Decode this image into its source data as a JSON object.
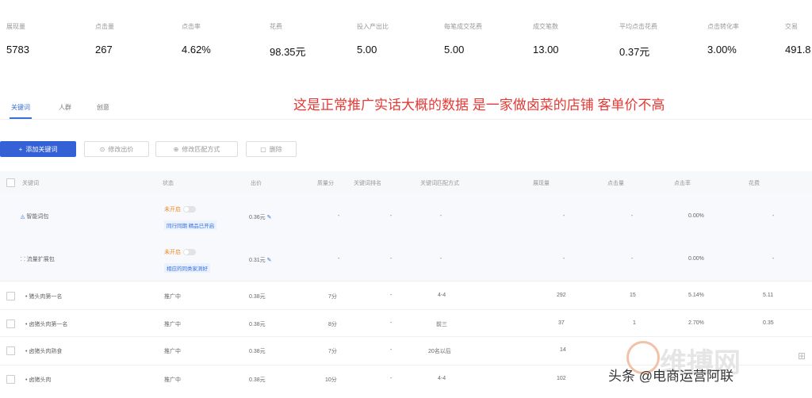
{
  "metrics": [
    {
      "label": "展现量",
      "value": "5783"
    },
    {
      "label": "点击量",
      "value": "267"
    },
    {
      "label": "点击率",
      "value": "4.62%"
    },
    {
      "label": "花费",
      "value": "98.35元"
    },
    {
      "label": "投入产出比",
      "value": "5.00"
    },
    {
      "label": "每笔成交花费",
      "value": "5.00"
    },
    {
      "label": "成交笔数",
      "value": "13.00"
    },
    {
      "label": "平均点击花费",
      "value": "0.37元"
    },
    {
      "label": "点击转化率",
      "value": "3.00%"
    },
    {
      "label": "交易",
      "value": "491.8"
    }
  ],
  "tabs": [
    "关键词",
    "人群",
    "创意"
  ],
  "note": "这是正常推广实话大概的数据 是一家做卤菜的店铺 客单价不高",
  "toolbar": {
    "add": "添加关键词",
    "modify_bid": "修改出价",
    "modify_match": "修改匹配方式",
    "delete": "删除"
  },
  "table": {
    "headers": [
      "关键词",
      "状态",
      "出价",
      "质量分",
      "关键词排名",
      "关键词匹配方式",
      "展现量",
      "点击量",
      "点击率",
      "花费"
    ],
    "rows": [
      {
        "name": "智能词包",
        "status": "未开启",
        "tag": "同行同期 精品已开启",
        "bid": "0.36元",
        "quality": "-",
        "rank": "-",
        "match": "-",
        "impr": "-",
        "clicks": "-",
        "ctr": "0.00%",
        "cost": "-"
      },
      {
        "name": "流量扩展包",
        "status": "未开启",
        "tag": "相应的同类家测好",
        "bid": "0.31元",
        "quality": "-",
        "rank": "-",
        "match": "-",
        "impr": "-",
        "clicks": "-",
        "ctr": "0.00%",
        "cost": "-"
      },
      {
        "name": "猪头肉第一名",
        "status": "推广中",
        "tag": "",
        "bid": "0.38元",
        "quality": "7分",
        "rank": "-",
        "match": "4-4",
        "impr": "292",
        "clicks": "15",
        "ctr": "5.14%",
        "cost": "5.11"
      },
      {
        "name": "卤猪头肉第一名",
        "status": "推广中",
        "tag": "",
        "bid": "0.38元",
        "quality": "8分",
        "rank": "-",
        "match": "前三",
        "impr": "37",
        "clicks": "1",
        "ctr": "2.70%",
        "cost": "0.35"
      },
      {
        "name": "卤猪头肉熟食",
        "status": "推广中",
        "tag": "",
        "bid": "0.38元",
        "quality": "7分",
        "rank": "-",
        "match": "20名以后",
        "impr": "14",
        "clicks": "",
        "ctr": "",
        "cost": ""
      },
      {
        "name": "卤猪头肉",
        "status": "推广中",
        "tag": "",
        "bid": "0.38元",
        "quality": "10分",
        "rank": "-",
        "match": "4-4",
        "impr": "102",
        "clicks": "",
        "ctr": "",
        "cost": ""
      }
    ]
  },
  "watermark": "维搏网",
  "credit": "头条 @电商运营阿联"
}
